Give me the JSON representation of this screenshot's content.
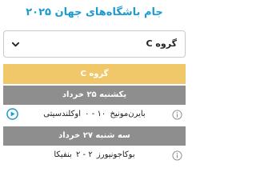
{
  "header": {
    "title": "جام باشگاه‌های جهان ۲۰۲۵"
  },
  "group_select": {
    "selected": "گروه C"
  },
  "group_header": {
    "label": "گروه C"
  },
  "days": [
    {
      "label": "یکشنبه ۲۵ خرداد",
      "matches": [
        {
          "home": "بایرن‌مونیخ",
          "score": "۱۰ - ۰",
          "away": "اوکلندسیتی",
          "icons": [
            "info-icon",
            "play-icon"
          ]
        }
      ]
    },
    {
      "label": "سه شنبه ۲۷ خرداد",
      "matches": [
        {
          "home": "بوکاجونیورز",
          "score": "۲ - ۲",
          "away": "بنفیکا",
          "icons": [
            "info-icon"
          ]
        }
      ]
    }
  ],
  "colors": {
    "title": "#1a9bd1",
    "group_header_bg": "#f0c86a",
    "day_header_bg": "#8e8e8e",
    "play_icon": "#1a9bd1"
  }
}
